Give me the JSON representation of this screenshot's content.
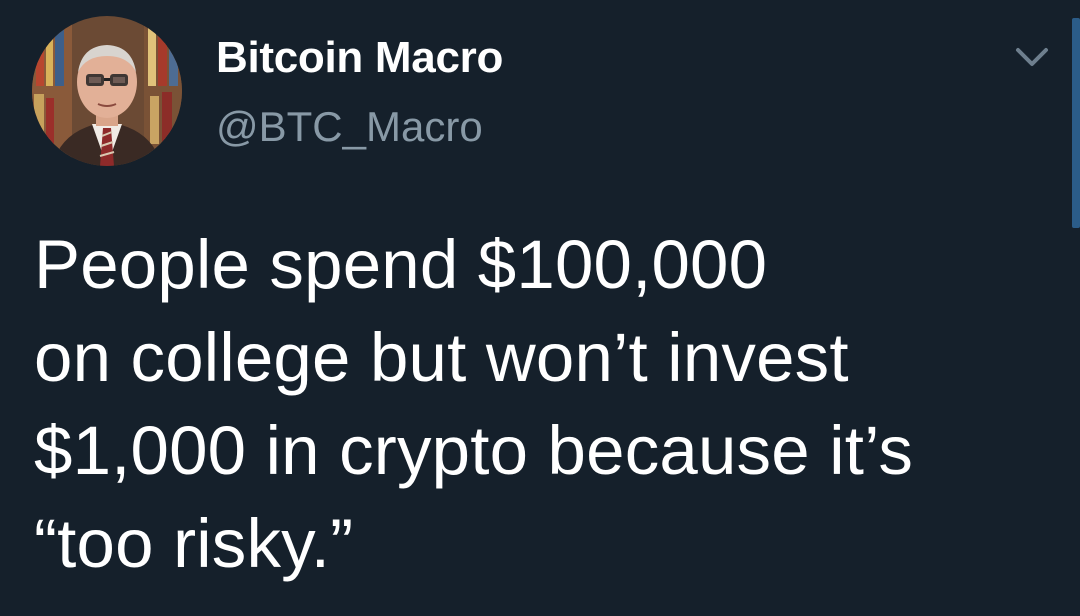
{
  "tweet": {
    "author": {
      "display_name": "Bitcoin Macro",
      "handle": "@BTC_Macro",
      "avatar_icon": "profile-photo"
    },
    "menu_icon": "chevron-down-icon",
    "text_lines": [
      "People spend $100,000",
      "on college but won’t invest",
      "$1,000 in crypto because it’s",
      "“too risky.”"
    ]
  },
  "colors": {
    "background": "#15202b",
    "primary_text": "#ffffff",
    "secondary_text": "#8899a6",
    "scrollbar": "#2b5c88"
  }
}
